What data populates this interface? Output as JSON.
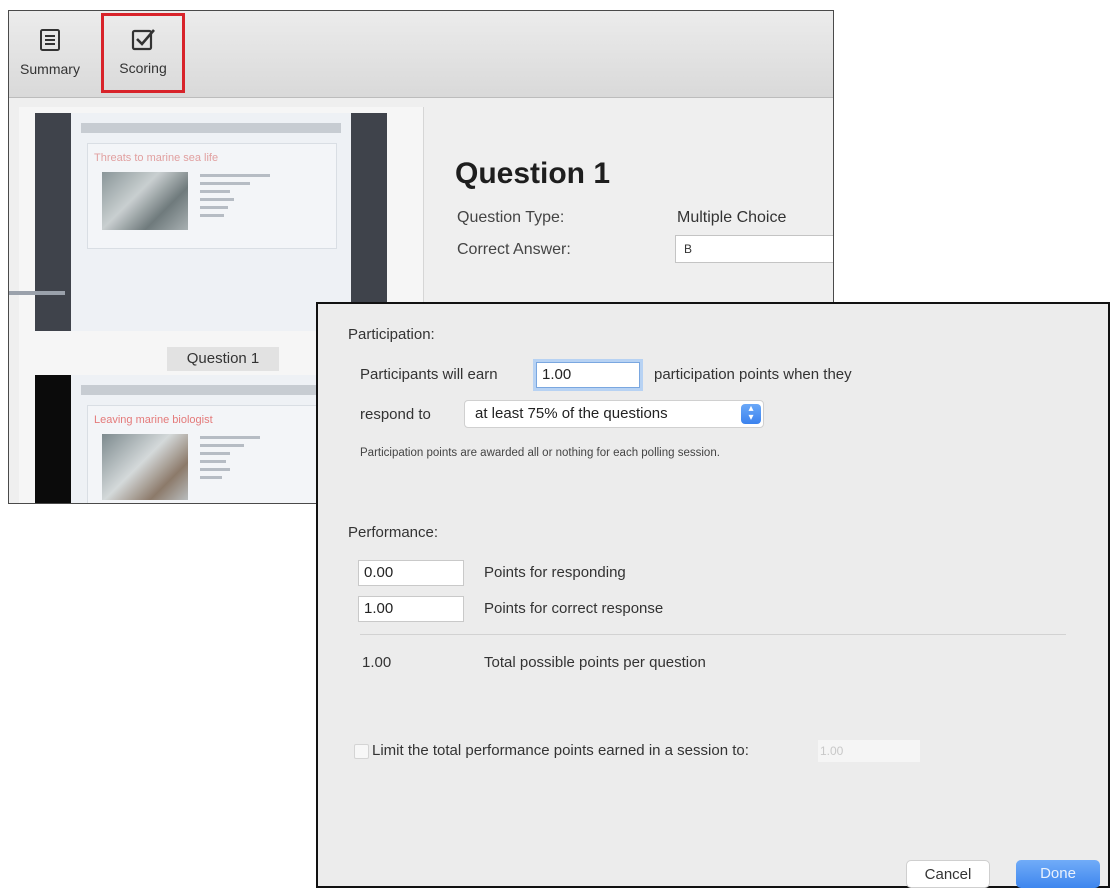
{
  "toolbar": {
    "summary_label": "Summary",
    "scoring_label": "Scoring",
    "highlight_color": "#d8232a"
  },
  "thumbnails": {
    "slide1_title": "Threats to marine sea life",
    "slide1_caption": "Question 1",
    "slide2_title": "Leaving marine biologist"
  },
  "question": {
    "title": "Question 1",
    "type_label": "Question Type:",
    "type_value": "Multiple Choice",
    "answer_label": "Correct Answer:",
    "answer_value": "B"
  },
  "dialog": {
    "participation": {
      "heading": "Participation:",
      "earn_prefix": "Participants will earn",
      "earn_value": "1.00",
      "earn_suffix": "participation points when they",
      "respond_label": "respond to",
      "respond_option": "at least 75% of the questions",
      "note": "Participation points are awarded all or nothing for each polling session."
    },
    "performance": {
      "heading": "Performance:",
      "responding_value": "0.00",
      "responding_label": "Points for responding",
      "correct_value": "1.00",
      "correct_label": "Points for correct response",
      "total_value": "1.00",
      "total_label": "Total possible points per question"
    },
    "limit": {
      "label": "Limit the total performance points earned in a session to:",
      "value": "1.00",
      "checked": false
    },
    "buttons": {
      "cancel": "Cancel",
      "done": "Done"
    },
    "accent_color": "#3e86ee"
  }
}
